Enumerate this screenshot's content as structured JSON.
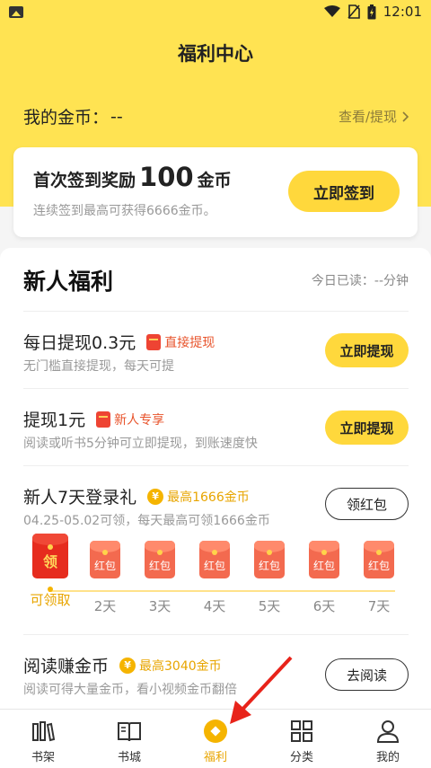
{
  "status_bar": {
    "time": "12:01"
  },
  "header": {
    "title": "福利中心",
    "coin_label": "我的金币：",
    "coin_value": "--",
    "coin_link": "查看/提现",
    "link_chevron": "chevron-right-icon"
  },
  "checkin": {
    "title_prefix": "首次签到奖励",
    "amount": "100",
    "title_suffix": "金币",
    "subtitle": "连续签到最高可获得6666金币。",
    "button": "立即签到"
  },
  "newbie": {
    "title": "新人福利",
    "meta": "今日已读：--分钟"
  },
  "tasks": [
    {
      "title": "每日提现0.3元",
      "tag": "直接提现",
      "subtitle": "无门槛直接提现，每天可提",
      "button": "立即提现"
    },
    {
      "title": "提现1元",
      "tag": "新人专享",
      "subtitle": "阅读或听书5分钟可立即提现，到账速度快",
      "button": "立即提现"
    },
    {
      "title": "新人7天登录礼",
      "tag": "最高1666金币",
      "subtitle": "04.25-05.02可领，每天最高可领1666金币",
      "button": "领红包"
    },
    {
      "title": "阅读赚金币",
      "tag": "最高3040金币",
      "subtitle": "阅读可得大量金币，看小视频金币翻倍",
      "button": "去阅读"
    }
  ],
  "login_days": [
    {
      "label": "可领取",
      "envelope": "领"
    },
    {
      "label": "2天",
      "envelope": "红包"
    },
    {
      "label": "3天",
      "envelope": "红包"
    },
    {
      "label": "4天",
      "envelope": "红包"
    },
    {
      "label": "5天",
      "envelope": "红包"
    },
    {
      "label": "6天",
      "envelope": "红包"
    },
    {
      "label": "7天",
      "envelope": "红包"
    }
  ],
  "tabbar": [
    {
      "label": "书架",
      "icon": "bookshelf-icon"
    },
    {
      "label": "书城",
      "icon": "book-icon"
    },
    {
      "label": "福利",
      "icon": "welfare-icon",
      "active": true
    },
    {
      "label": "分类",
      "icon": "category-grid-icon"
    },
    {
      "label": "我的",
      "icon": "profile-icon"
    }
  ],
  "colors": {
    "accent": "#ffd83c",
    "header_bg": "#ffe352",
    "gold_text": "#e8a500",
    "red_tag": "#e8542c"
  }
}
